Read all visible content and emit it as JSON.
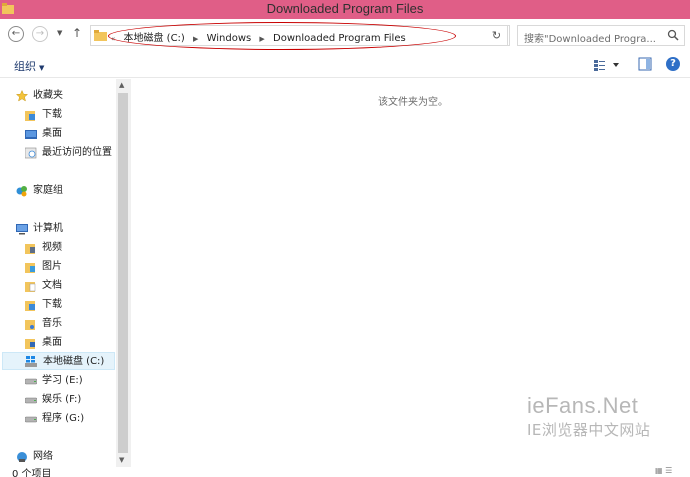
{
  "window": {
    "title": "Downloaded Program Files"
  },
  "navigation": {
    "back_icon": "back-arrow-icon",
    "forward_icon": "forward-arrow-icon",
    "recent_icon": "chevron-down-icon",
    "up_icon": "up-arrow-icon",
    "address": {
      "overflow": "«",
      "crumbs": [
        "本地磁盘 (C:)",
        "Windows",
        "Downloaded Program Files"
      ]
    },
    "refresh_icon": "refresh-icon",
    "search": {
      "placeholder": "搜索\"Downloaded Progra..."
    }
  },
  "commandbar": {
    "organize_label": "组织"
  },
  "sidebar": {
    "favorites": {
      "label": "收藏夹",
      "items": [
        "下载",
        "桌面",
        "最近访问的位置"
      ]
    },
    "homegroup": {
      "label": "家庭组"
    },
    "computer": {
      "label": "计算机",
      "items": [
        "视频",
        "图片",
        "文档",
        "下载",
        "音乐",
        "桌面",
        "本地磁盘 (C:)",
        "学习 (E:)",
        "娱乐 (F:)",
        "程序 (G:)"
      ]
    },
    "network": {
      "label": "网络"
    }
  },
  "main": {
    "empty_message": "该文件夹为空。"
  },
  "status": {
    "item_count": "0 个项目"
  },
  "watermark": {
    "line1": "ieFans.Net",
    "line2": "IE浏览器中文网站"
  },
  "colors": {
    "titlebar": "#e05e87",
    "selected_bg": "#e5f3fb",
    "annotation_oval": "#c80000"
  }
}
